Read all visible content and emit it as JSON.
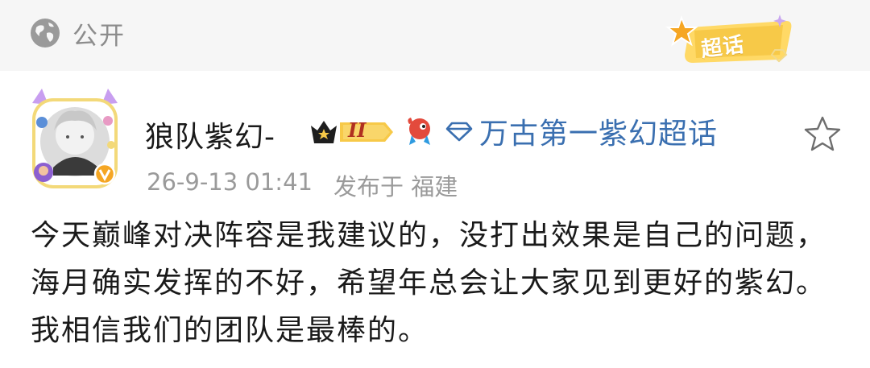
{
  "visibility": {
    "label": "公开",
    "icon": "globe-icon"
  },
  "supertopic_badge": {
    "label": "超话",
    "icon": "star-sparkle-icon"
  },
  "author": {
    "name": "狼队紫幻-",
    "vip_level": "II",
    "verified_icon": "verified-v-icon"
  },
  "topic": {
    "label": "万古第一紫幻超话",
    "icon": "diamond-icon"
  },
  "meta": {
    "timestamp": "26-9-13 01:41",
    "location": "发布于 福建"
  },
  "post": {
    "text": "今天巅峰对决阵容是我建议的，没打出效果是自己的问题，海月确实发挥的不好，希望年总会让大家见到更好的紫幻。我相信我们的团队是最棒的。"
  },
  "colors": {
    "topic_link": "#3a6fb0",
    "meta_text": "#9a9a9a",
    "top_bar_bg": "#f6f6f6",
    "badge_yellow": "#f7c948",
    "verified_orange": "#f5a623"
  }
}
